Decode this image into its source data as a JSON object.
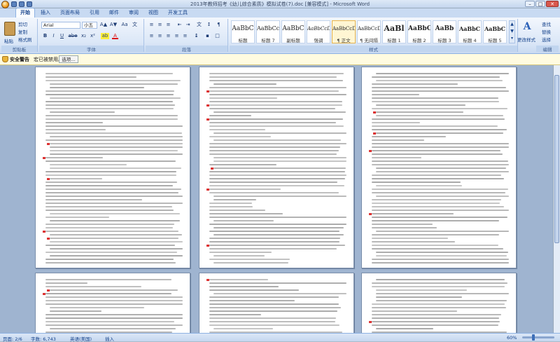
{
  "window": {
    "title": "2013年教师招考《幼儿综合素质》模拟试卷(7).doc [兼容模式] - Microsoft Word",
    "minimize": "–",
    "maximize": "□",
    "close": "✕"
  },
  "tabs": [
    {
      "label": "开始",
      "active": true
    },
    {
      "label": "插入",
      "active": false
    },
    {
      "label": "页面布局",
      "active": false
    },
    {
      "label": "引用",
      "active": false
    },
    {
      "label": "邮件",
      "active": false
    },
    {
      "label": "审阅",
      "active": false
    },
    {
      "label": "视图",
      "active": false
    },
    {
      "label": "开发工具",
      "active": false
    }
  ],
  "clipboard": {
    "paste": "粘贴",
    "cut": "剪切",
    "copy": "复制",
    "format_painter": "格式刷",
    "label": "剪贴板"
  },
  "font": {
    "name": "Arial",
    "size": "小五",
    "label": "字体",
    "bold": "B",
    "italic": "I",
    "underline": "U",
    "strike": "abe",
    "sub": "x₂",
    "sup": "x²",
    "clear": "Aa",
    "grow": "A▲",
    "shrink": "A▼",
    "highlight": "ab",
    "color": "A",
    "wen": "文"
  },
  "paragraph": {
    "label": "段落"
  },
  "styles": {
    "label": "样式",
    "tiles": [
      {
        "sample": "AaBbC",
        "name": "标题"
      },
      {
        "sample": "AaBbCc",
        "name": "标题 7"
      },
      {
        "sample": "AaBbC",
        "name": "副标题"
      },
      {
        "sample": "AaBbCcDd",
        "name": "强调"
      },
      {
        "sample": "AaBbCcDd",
        "name": "¶ 正文"
      },
      {
        "sample": "AaBbCcDd",
        "name": "¶ 无间隔"
      },
      {
        "sample": "AaBl",
        "name": "标题 1"
      },
      {
        "sample": "AaBbC",
        "name": "标题 2"
      },
      {
        "sample": "AaBb",
        "name": "标题 3"
      },
      {
        "sample": "AaBbC",
        "name": "标题 4"
      },
      {
        "sample": "AaBbC",
        "name": "标题 5"
      }
    ],
    "change": "更改样式"
  },
  "editing": {
    "find": "查找",
    "replace": "替换",
    "select": "选择",
    "label": "编辑"
  },
  "security": {
    "title": "安全警告",
    "message": "宏已被禁用。",
    "options": "选项..."
  },
  "status": {
    "page": "页面: 2/6",
    "words": "字数: 6,743",
    "lang": "英语(美国)",
    "mode": "插入",
    "zoom": "60%"
  }
}
